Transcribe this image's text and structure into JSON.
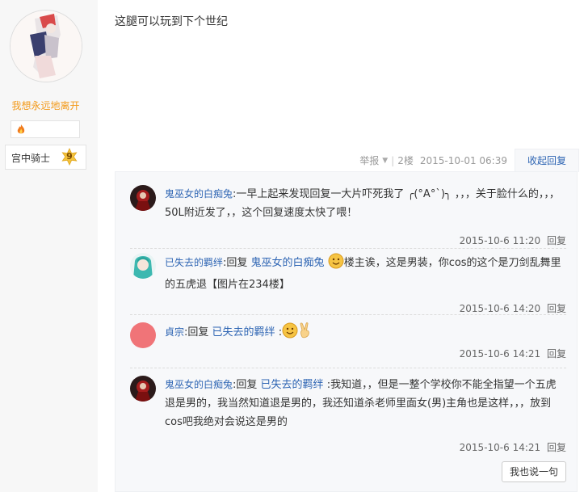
{
  "author": {
    "name": "我想永远地离开",
    "level_title": "宫中骑士",
    "level": "9"
  },
  "post": {
    "text": "这腿可以玩到下个世纪",
    "report_label": "举报",
    "separator": "|",
    "floor": "2楼",
    "date": "2015-10-01 06:39",
    "collapse_label": "收起回复"
  },
  "comments": [
    {
      "user": "鬼巫女的白痴兔",
      "text": ":一早上起来发现回复一大片吓死我了 ╭(°A°`)╮ ，，，关于脸什么的，，，50L附近发了，，这个回复速度太快了喂！",
      "time": "2015-10-6 11:20",
      "reply_label": "回复"
    },
    {
      "user": "已失去的羁绊",
      "reply_word": ":回复 ",
      "target": "鬼巫女的白痴兔",
      "text_after": "楼主诶，这是男装，你cos的这个是刀剑乱舞里的五虎退【图片在234楼】",
      "time": "2015-10-6 14:20",
      "reply_label": "回复"
    },
    {
      "user": "貞宗",
      "reply_word": ":回复 ",
      "target": "已失去的羁绊",
      "text_after": ":",
      "time": "2015-10-6 14:21",
      "reply_label": "回复"
    },
    {
      "user": "鬼巫女的白痴兔",
      "reply_word": ":回复 ",
      "target": "已失去的羁绊",
      "text_after": ":我知道，，但是一整个学校你不能全指望一个五虎退是男的，我当然知道退是男的，我还知道杀老师里面女(男)主角也是这样，，，放到cos吧我绝对会说这是男的",
      "time": "2015-10-6 14:21",
      "reply_label": "回复"
    }
  ],
  "say_button": "我也说一句",
  "icons": {
    "flame": "flame-icon",
    "level_badge": "star-badge-icon",
    "caret": "chevron-down-icon"
  },
  "colors": {
    "link": "#2d64b3",
    "username": "#f39a1a",
    "muted": "#999999"
  }
}
